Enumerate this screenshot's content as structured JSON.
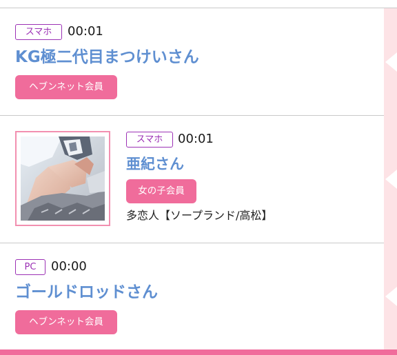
{
  "rows": [
    {
      "device": "スマホ",
      "time": "00:01",
      "name": "KG極二代目まつけいさん",
      "member": "ヘブンネット会員",
      "shop": ""
    },
    {
      "device": "スマホ",
      "time": "00:01",
      "name": "亜紀さん",
      "member": "女の子会員",
      "shop": "多恋人【ソープランド/高松】",
      "thumbnail": "profile-photo"
    },
    {
      "device": "PC",
      "time": "00:00",
      "name": "ゴールドロッドさん",
      "member": "ヘブンネット会員",
      "shop": ""
    }
  ],
  "colors": {
    "accent_pink": "#f06c9b",
    "device_purple": "#9b30b5",
    "name_blue": "#5f8fd1",
    "rail_pink": "#fde3e6"
  }
}
